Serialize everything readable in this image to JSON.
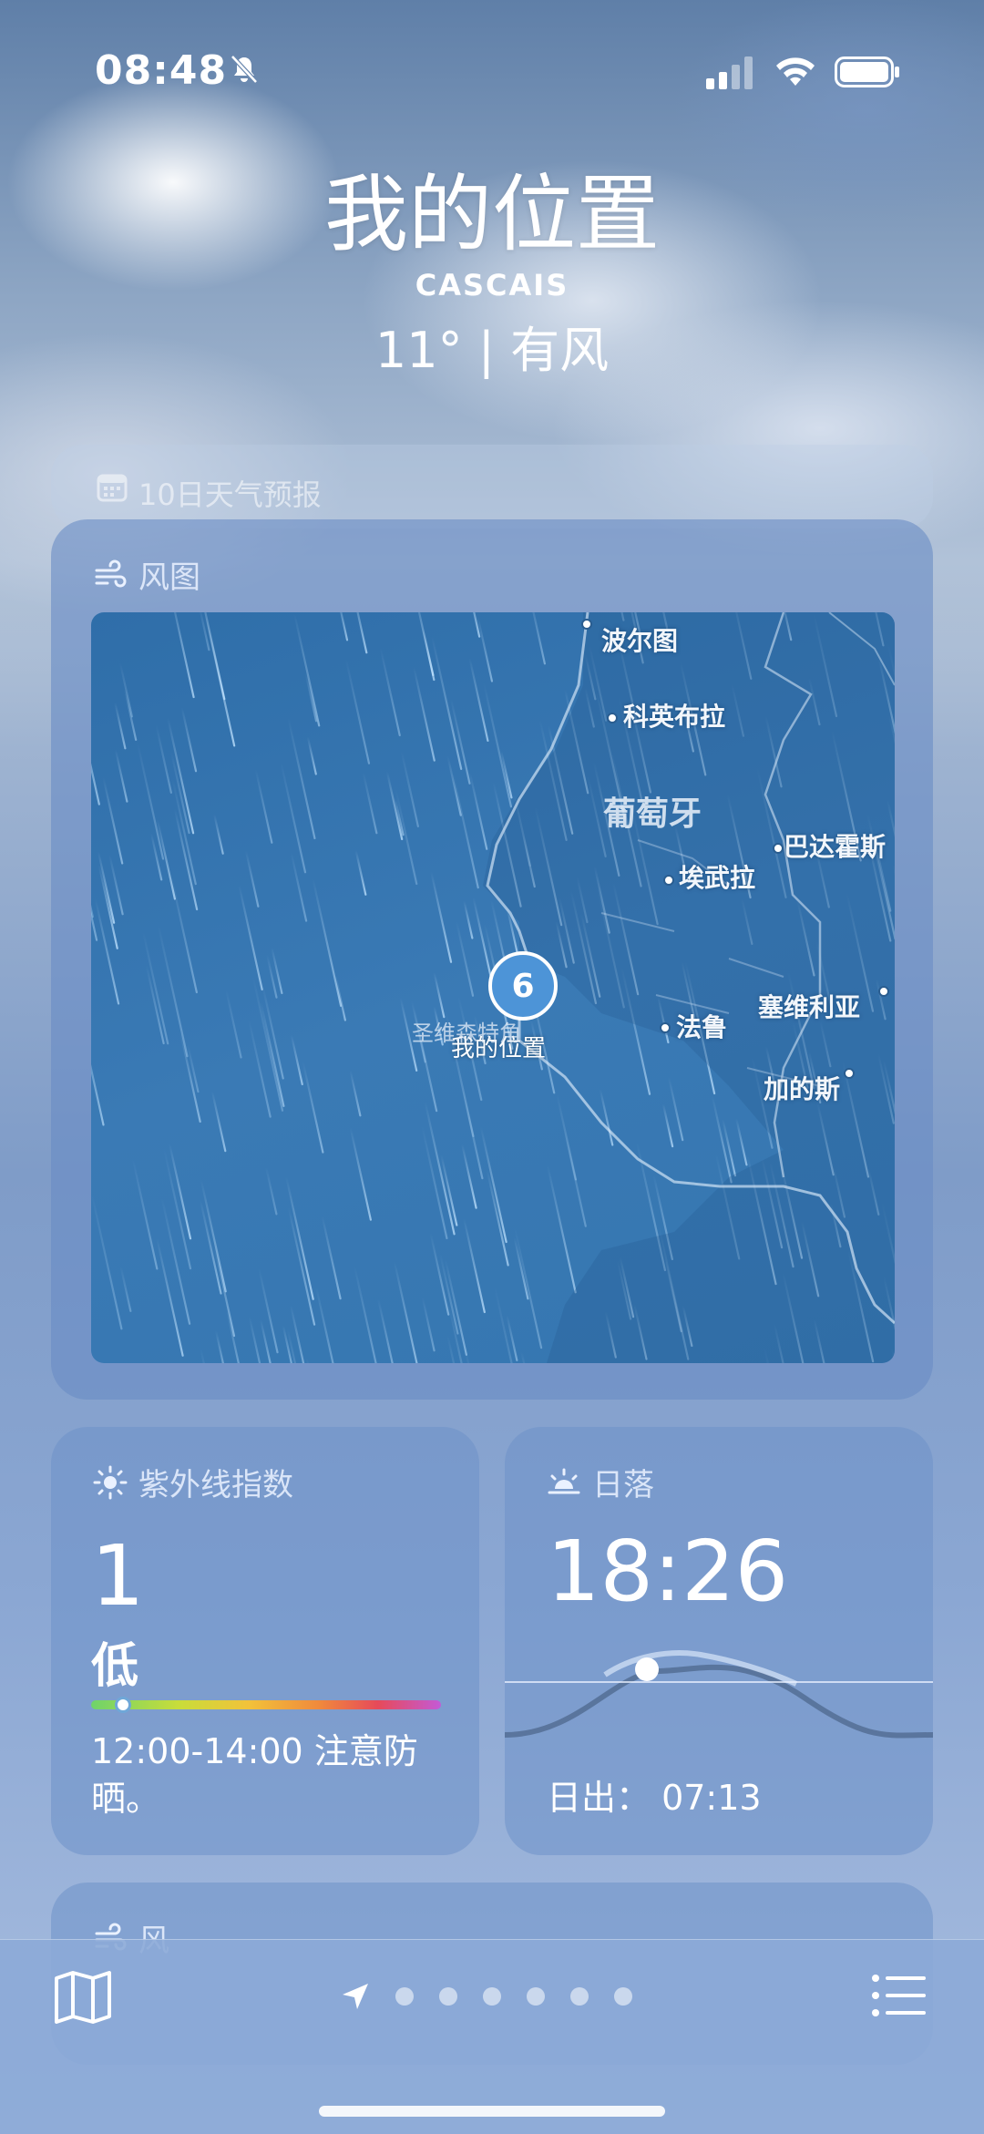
{
  "status_bar": {
    "time": "08:48"
  },
  "header": {
    "title": "我的位置",
    "subtitle": "CASCAIS",
    "temp_condition": "11° | 有风"
  },
  "forecast": {
    "label": "10日天气预报",
    "icon": "calendar-icon"
  },
  "wind_map": {
    "label": "风图",
    "icon": "wind-icon",
    "pin_value": "6",
    "pin_label": "我的位置",
    "cities": [
      "波尔图",
      "科英布拉",
      "巴达霍斯",
      "埃武拉",
      "塞维利亚",
      "法鲁",
      "加的斯"
    ],
    "country": "葡萄牙",
    "cape": "圣维森特角"
  },
  "uv": {
    "label": "紫外线指数",
    "icon": "sun-icon",
    "value": "1",
    "level": "低",
    "note": "12:00-14:00 注意防晒。",
    "level_fraction": 0.09
  },
  "sunset": {
    "label": "日落",
    "icon": "sunset-icon",
    "time": "18:26",
    "sunrise": "日出： 07:13"
  },
  "wind_card": {
    "label": "风",
    "icon": "wind-icon"
  },
  "tabbar": {
    "page_count": 6,
    "map_icon": "map-icon",
    "list_icon": "list-icon",
    "location_icon": "location-arrow-icon"
  }
}
